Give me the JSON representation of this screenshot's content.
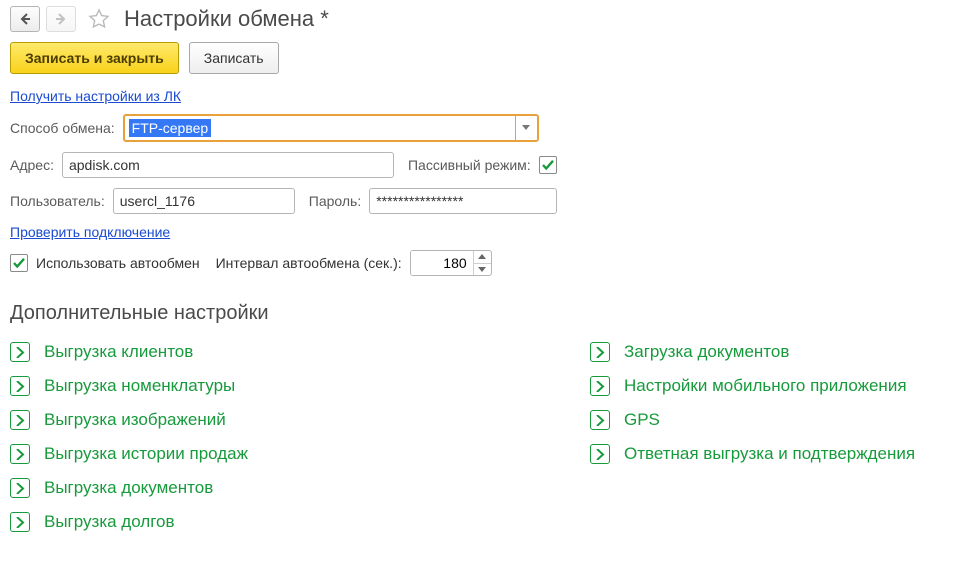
{
  "header": {
    "title": "Настройки обмена *"
  },
  "toolbar": {
    "save_close_label": "Записать и закрыть",
    "save_label": "Записать"
  },
  "get_settings_link": "Получить настройки из ЛК",
  "exchange_method": {
    "label": "Способ обмена:",
    "value": "FTP-сервер"
  },
  "address": {
    "label": "Адрес:",
    "value": "apdisk.com"
  },
  "passive_mode": {
    "label": "Пассивный режим:",
    "checked": true
  },
  "user": {
    "label": "Пользователь:",
    "value": "usercl_1176"
  },
  "password": {
    "label": "Пароль:",
    "value": "****************"
  },
  "check_connection_link": "Проверить подключение",
  "auto_exchange": {
    "use_label": "Использовать автообмен",
    "checked": true,
    "interval_label": "Интервал автообмена (сек.):",
    "interval_value": "180"
  },
  "additional_settings_header": "Дополнительные настройки",
  "additional_left": [
    "Выгрузка клиентов",
    "Выгрузка номенклатуры",
    "Выгрузка изображений",
    "Выгрузка истории продаж",
    "Выгрузка документов",
    "Выгрузка долгов"
  ],
  "additional_right": [
    "Загрузка документов",
    "Настройки мобильного приложения",
    "GPS",
    "Ответная выгрузка и подтверждения"
  ]
}
